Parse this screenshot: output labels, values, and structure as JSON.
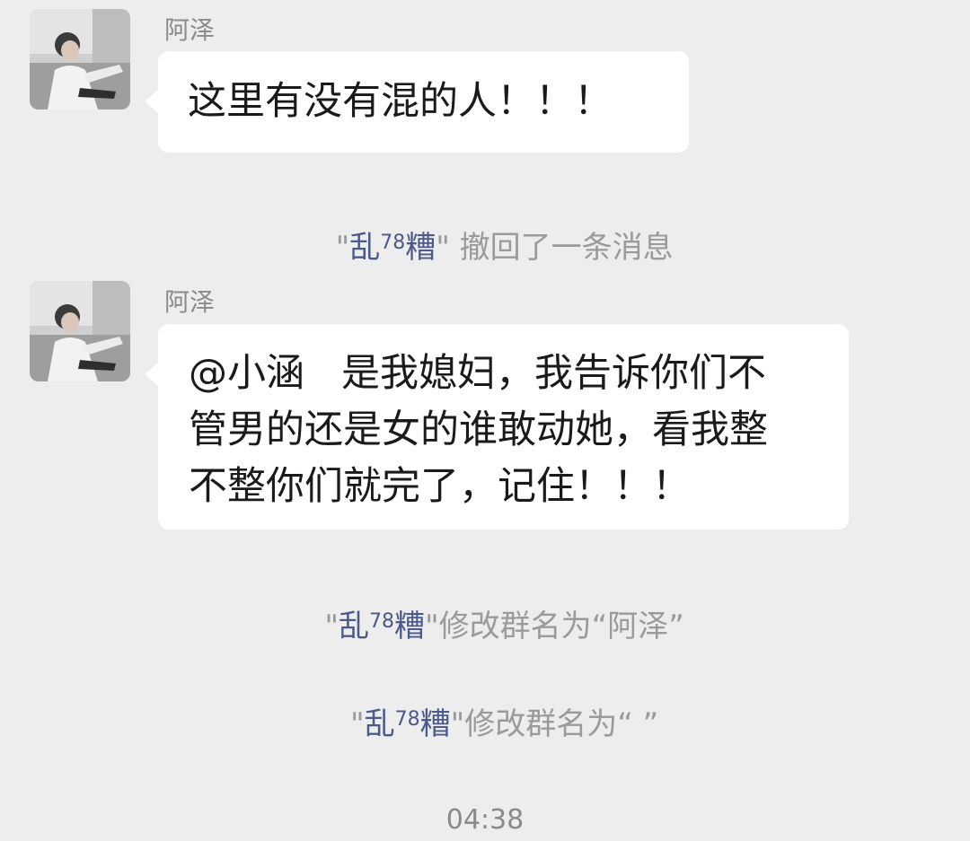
{
  "messages": [
    {
      "sender": "阿泽",
      "text": "这里有没有混的人！！！"
    },
    {
      "sender": "阿泽",
      "lines": [
        "@小涵   是我媳妇，我告诉你们不",
        "管男的还是女的谁敢动她，看我整",
        "不整你们就完了，记住！！！"
      ]
    }
  ],
  "system": {
    "recall": {
      "quote_open": "\"",
      "name": "乱",
      "name_sup": "78",
      "name_end": "糟",
      "quote_close": "\"",
      "action": " 撤回了一条消息"
    },
    "rename1": {
      "quote_open": "\"",
      "name": "乱",
      "name_sup": "78",
      "name_end": "糟",
      "quote_close": "\"",
      "action": "修改群名为“阿泽”"
    },
    "rename2": {
      "quote_open": "\"",
      "name": "乱",
      "name_sup": "78",
      "name_end": "糟",
      "quote_close": "\"",
      "action": "修改群名为“ ”"
    }
  },
  "timestamp": "04:38",
  "colors": {
    "background": "#ededed",
    "bubble": "#ffffff",
    "system_name": "#4a5a8a",
    "system_text": "#9a9a9a"
  }
}
